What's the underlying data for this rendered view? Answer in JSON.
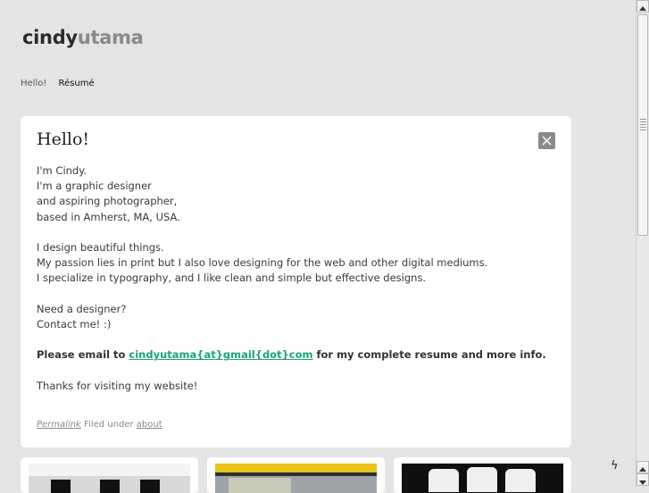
{
  "logo": {
    "part1": "cindy",
    "part2": "utama"
  },
  "nav": {
    "items": [
      {
        "label": "Hello!"
      },
      {
        "label": "Résumé"
      }
    ]
  },
  "post": {
    "title": "Hello!",
    "lines1": [
      "I'm Cindy.",
      "I'm a graphic designer",
      "and aspiring photographer,",
      "based in Amherst, MA, USA."
    ],
    "lines2": [
      "I design beautiful things.",
      "My passion lies in print but I also love designing for the web and other digital mediums.",
      "I specialize in typography, and I like clean and simple but effective designs."
    ],
    "lines3": [
      "Need a designer?",
      "Contact me! :)"
    ],
    "email_prefix": "Please email to ",
    "email": "cindyutama{at}gmail{dot}com",
    "email_suffix": " for my complete resume and more info.",
    "thanks": "Thanks for visiting my website!",
    "permalink": "Permalink",
    "filed_under": "Filed under",
    "category": "about"
  },
  "colors": {
    "accent": "#1aa37a",
    "card": "#ffffff",
    "background": "#e4e4e4"
  },
  "icons": {
    "close": "close-icon",
    "lightning": "lightning-icon"
  }
}
